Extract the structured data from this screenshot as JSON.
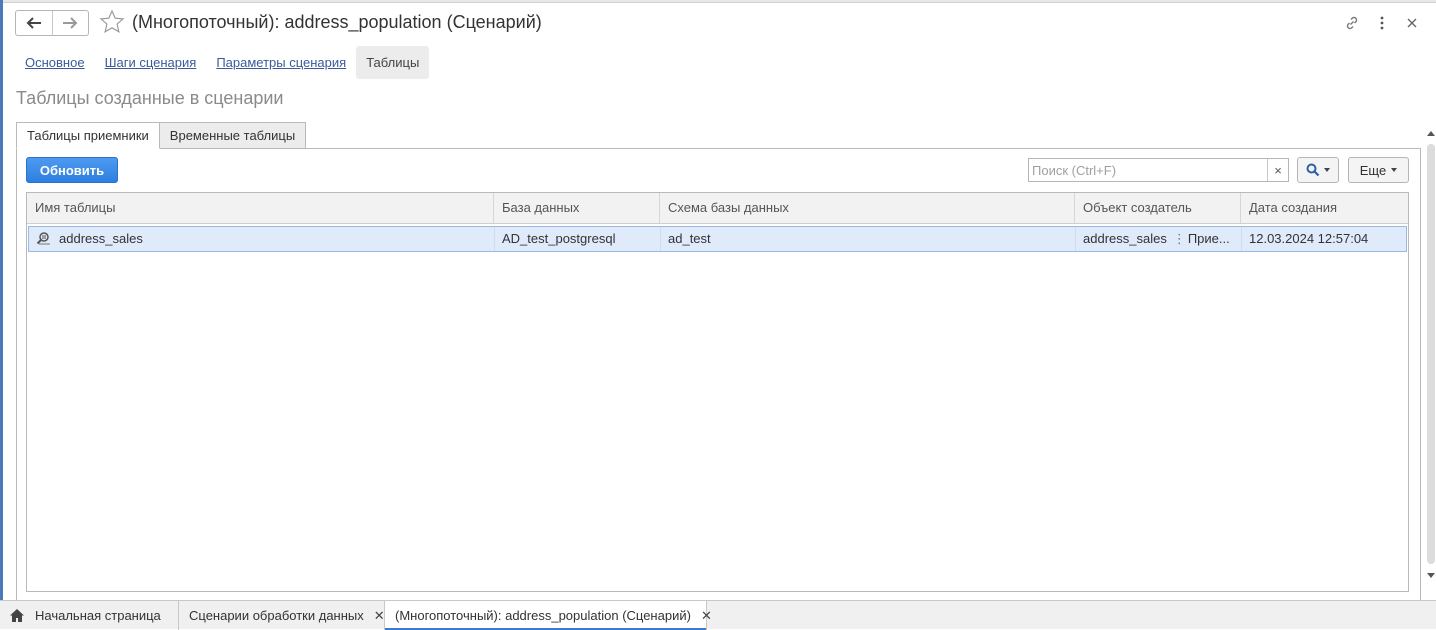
{
  "window": {
    "title": "(Многопоточный): address_population (Сценарий)"
  },
  "section_tabs": [
    {
      "label": "Основное"
    },
    {
      "label": "Шаги сценария"
    },
    {
      "label": "Параметры сценария"
    },
    {
      "label": "Таблицы"
    }
  ],
  "heading": "Таблицы созданные в сценарии",
  "inner_tabs": [
    {
      "label": "Таблицы приемники"
    },
    {
      "label": "Временные таблицы"
    }
  ],
  "toolbar": {
    "refresh_label": "Обновить",
    "search_placeholder": "Поиск (Ctrl+F)",
    "search_clear": "×",
    "more_label": "Еще"
  },
  "table": {
    "columns": [
      "Имя таблицы",
      "База данных",
      "Схема базы данных",
      "Объект создатель",
      "Дата создания"
    ],
    "rows": [
      {
        "name": "address_sales",
        "database": "AD_test_postgresql",
        "schema": "ad_test",
        "creator_name": "address_sales",
        "creator_type": "Прие...",
        "created": "12.03.2024 12:57:04"
      }
    ]
  },
  "taskbar": [
    {
      "label": "Начальная страница"
    },
    {
      "label": "Сценарии обработки данных"
    },
    {
      "label": "(Многопоточный): address_population (Сценарий)"
    }
  ],
  "colors": {
    "accent": "#2d7fe0",
    "link": "#3a5a9a",
    "row_selected": "#dfeafb"
  },
  "icons": {
    "back": "arrow-left-icon",
    "forward": "arrow-right-icon",
    "favorite": "star-icon",
    "link": "link-icon",
    "menu": "more-vertical-icon",
    "close": "close-icon",
    "search": "search-icon",
    "row": "table-search-icon",
    "home": "home-icon"
  }
}
